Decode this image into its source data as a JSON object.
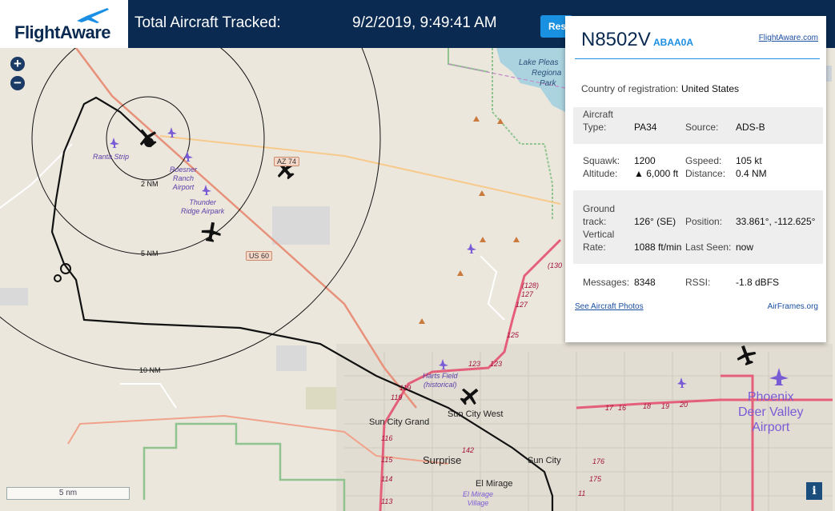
{
  "header": {
    "logo_text": "FlightAware",
    "total_label": "Total Aircraft Tracked:",
    "timestamp": "9/2/2019, 9:49:41 AM",
    "reset_label": "Res"
  },
  "map_controls": {
    "zoom_in": "+",
    "zoom_out": "−",
    "scale_label": "5 nm",
    "info_label": "i"
  },
  "popup": {
    "registration": "N8502V",
    "hex": "ABAA0A",
    "fa_link": "FlightAware.com",
    "country_label": "Country of registration:",
    "country": "United States",
    "aircraft_type_label_1": "Aircraft",
    "aircraft_type_label_2": "Type:",
    "aircraft_type": "PA34",
    "source_label": "Source:",
    "source": "ADS-B",
    "squawk_label": "Squawk:",
    "squawk": "1200",
    "gspeed_label": "Gspeed:",
    "gspeed": "105 kt",
    "altitude_label": "Altitude:",
    "altitude": "▲ 6,000 ft",
    "distance_label": "Distance:",
    "distance": "0.4 NM",
    "ground_track_label_1": "Ground",
    "ground_track_label_2": "track:",
    "ground_track": "126° (SE)",
    "position_label": "Position:",
    "position": "33.861°, -112.625°",
    "vrate_label_1": "Vertical",
    "vrate_label_2": "Rate:",
    "vrate": "1088 ft/min",
    "last_seen_label": "Last Seen:",
    "last_seen": "now",
    "messages_label": "Messages:",
    "messages": "8348",
    "rssi_label": "RSSI:",
    "rssi": "-1.8 dBFS",
    "photos_link": "See Aircraft Photos",
    "airframes_link": "AirFrames.org"
  },
  "map_labels": {
    "ring_2": "2 NM",
    "ring_5": "5 NM",
    "ring_10": "10 NM",
    "az74": "AZ 74",
    "us60": "US 60",
    "ranta": "Ranta Strip",
    "roesner_1": "Roesner",
    "roesner_2": "Ranch",
    "roesner_3": "Airport",
    "thunder_1": "Thunder",
    "thunder_2": "Ridge Airpark",
    "harts_1": "Harts Field",
    "harts_2": "(historical)",
    "lake_1": "Lake Pleas",
    "lake_2": "Regiona",
    "lake_3": "Park",
    "sun_city_grand": "Sun City Grand",
    "sun_city_west": "Sun City West",
    "surprise": "Surprise",
    "sun_city": "Sun City",
    "el_mirage": "El Mirage",
    "el_mirage_v_1": "El Mirage",
    "el_mirage_v_2": "Village",
    "phoenix_1": "Phoenix",
    "phoenix_2": "Deer Valley",
    "phoenix_3": "Airport",
    "r130": "(130",
    "r128": "(128)",
    "r127a": "127",
    "r127b": "127",
    "r125": "125",
    "r123a": "123",
    "r123b": "123",
    "r119a": "119",
    "r119b": "119",
    "r116": "116",
    "r115": "115",
    "r114": "114",
    "r113": "113",
    "r142": "142",
    "r17": "17",
    "r16": "16",
    "r19": "19",
    "r18": "18",
    "r20": "20",
    "r176": "176",
    "r175": "175",
    "r11": "11"
  }
}
